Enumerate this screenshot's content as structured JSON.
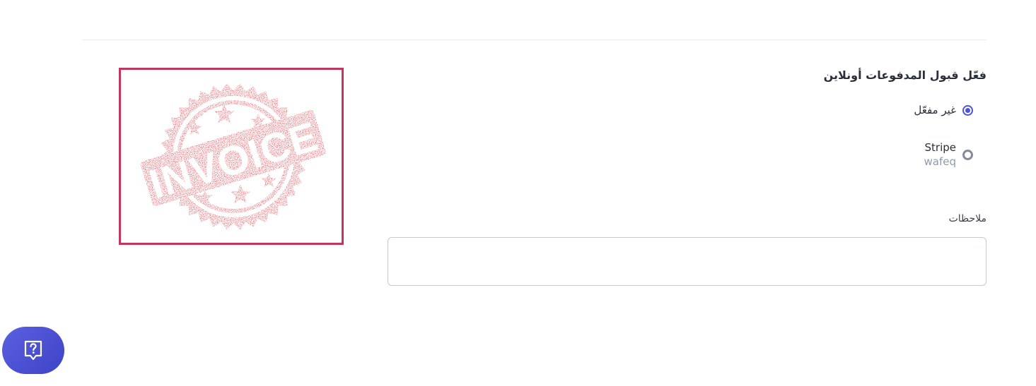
{
  "payments": {
    "title": "فعّل قبول المدفوعات أونلاين",
    "options": [
      {
        "label": "غير مفعّل",
        "checked": true
      },
      {
        "label": "Stripe",
        "sublabel": "wafeq",
        "checked": false
      }
    ]
  },
  "notes": {
    "label": "ملاحظات",
    "value": ""
  },
  "stamp": {
    "text": "INVOICE",
    "color": "#d3232f",
    "border_color": "#c2355c"
  },
  "help": {
    "icon": "help-question-icon"
  },
  "colors": {
    "accent": "#4f55d6"
  }
}
